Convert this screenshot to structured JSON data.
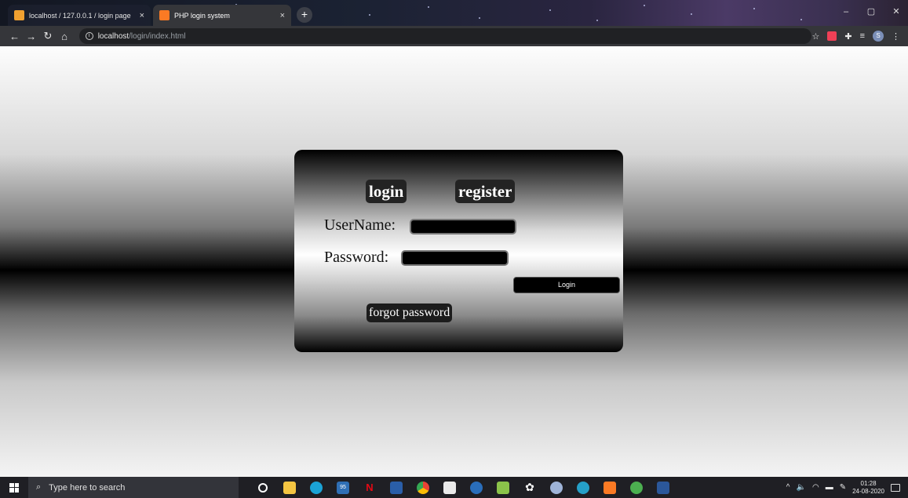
{
  "browser": {
    "tabs": [
      {
        "title": "localhost / 127.0.0.1 / login page",
        "active": false
      },
      {
        "title": "PHP login system",
        "active": true
      }
    ],
    "new_tab": "+",
    "tab_close": "×",
    "url_host": "localhost",
    "url_path": "/login/index.html",
    "toolbar_icons": [
      "back-icon",
      "forward-icon",
      "reload-icon",
      "home-icon",
      "info-icon",
      "bookmark-star-icon",
      "pocket-icon",
      "extensions-icon",
      "reading-list-icon",
      "avatar",
      "menu-icon"
    ],
    "avatar_letter": "S"
  },
  "login_card": {
    "login_tab": "login",
    "register_tab": "register",
    "username_label": "UserName:",
    "password_label": "Password:",
    "login_button": "Login",
    "forgot_password": "forgot password"
  },
  "taskbar": {
    "search_placeholder": "Type here to search",
    "badge_count": "95",
    "time": "01:28",
    "date": "24-08-2020"
  }
}
